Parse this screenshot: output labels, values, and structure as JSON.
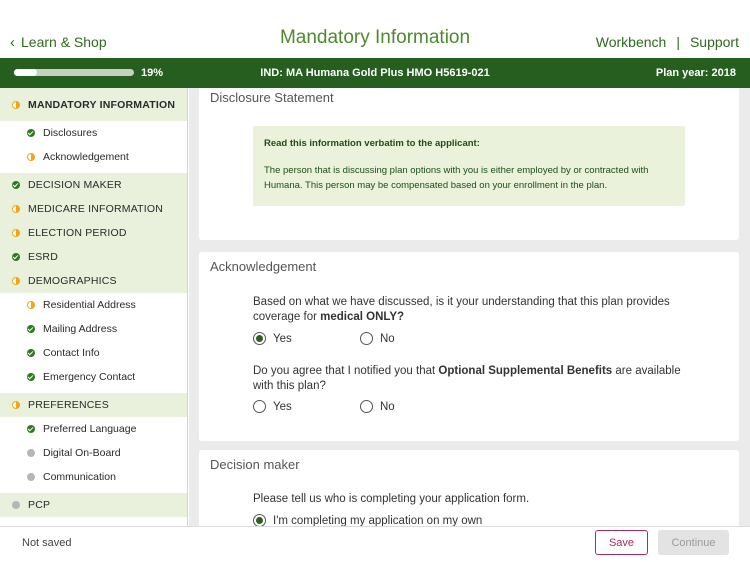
{
  "header": {
    "back_label": "Learn & Shop",
    "title": "Mandatory Information",
    "links": [
      "Workbench",
      "Support"
    ],
    "separator": "|"
  },
  "plan_bar": {
    "progress_fraction": 0.19,
    "progress_label": "19%",
    "plan_name": "IND: MA Humana Gold Plus HMO H5619-021",
    "plan_year": "Plan year: 2018"
  },
  "sidebar": {
    "items": [
      {
        "label": "MANDATORY INFORMATION",
        "level": "top",
        "status": "partial"
      },
      {
        "label": "Disclosures",
        "level": "sub",
        "status": "done"
      },
      {
        "label": "Acknowledgement",
        "level": "sub",
        "status": "partial"
      },
      {
        "label": "DECISION MAKER",
        "level": "top",
        "status": "done"
      },
      {
        "label": "MEDICARE INFORMATION",
        "level": "top",
        "status": "partial"
      },
      {
        "label": "ELECTION PERIOD",
        "level": "top",
        "status": "partial"
      },
      {
        "label": "ESRD",
        "level": "top",
        "status": "done"
      },
      {
        "label": "DEMOGRAPHICS",
        "level": "top",
        "status": "partial"
      },
      {
        "label": "Residential Address",
        "level": "sub",
        "status": "partial"
      },
      {
        "label": "Mailing Address",
        "level": "sub",
        "status": "done"
      },
      {
        "label": "Contact Info",
        "level": "sub",
        "status": "done"
      },
      {
        "label": "Emergency Contact",
        "level": "sub",
        "status": "done"
      },
      {
        "label": "PREFERENCES",
        "level": "top",
        "status": "partial"
      },
      {
        "label": "Preferred Language",
        "level": "sub",
        "status": "done"
      },
      {
        "label": "Digital On-Board",
        "level": "sub",
        "status": "pending"
      },
      {
        "label": "Communication",
        "level": "sub",
        "status": "pending"
      },
      {
        "label": "PCP",
        "level": "top",
        "status": "pending"
      }
    ]
  },
  "disclosure": {
    "title": "Disclosure Statement",
    "notice_heading": "Read this information verbatim to the applicant:",
    "notice_body": "The person that is discussing plan options with you is either employed by or contracted with Humana. This person may be compensated based on your enrollment in the plan."
  },
  "acknowledgement": {
    "title": "Acknowledgement",
    "q1_text": "Based on what we have discussed, is it your understanding that this plan provides coverage for ",
    "q1_bold": "medical ONLY?",
    "q2_text": "Do you agree that I notified you that ",
    "q2_bold": "Optional Supplemental Benefits",
    "q2_tail": " are available with this plan?",
    "yes": "Yes",
    "no": "No"
  },
  "decision_maker": {
    "title": "Decision maker",
    "question": "Please tell us who is completing your application form.",
    "option1": "I'm completing my application on my own"
  },
  "footer": {
    "status": "Not saved",
    "save": "Save",
    "continue": "Continue"
  }
}
